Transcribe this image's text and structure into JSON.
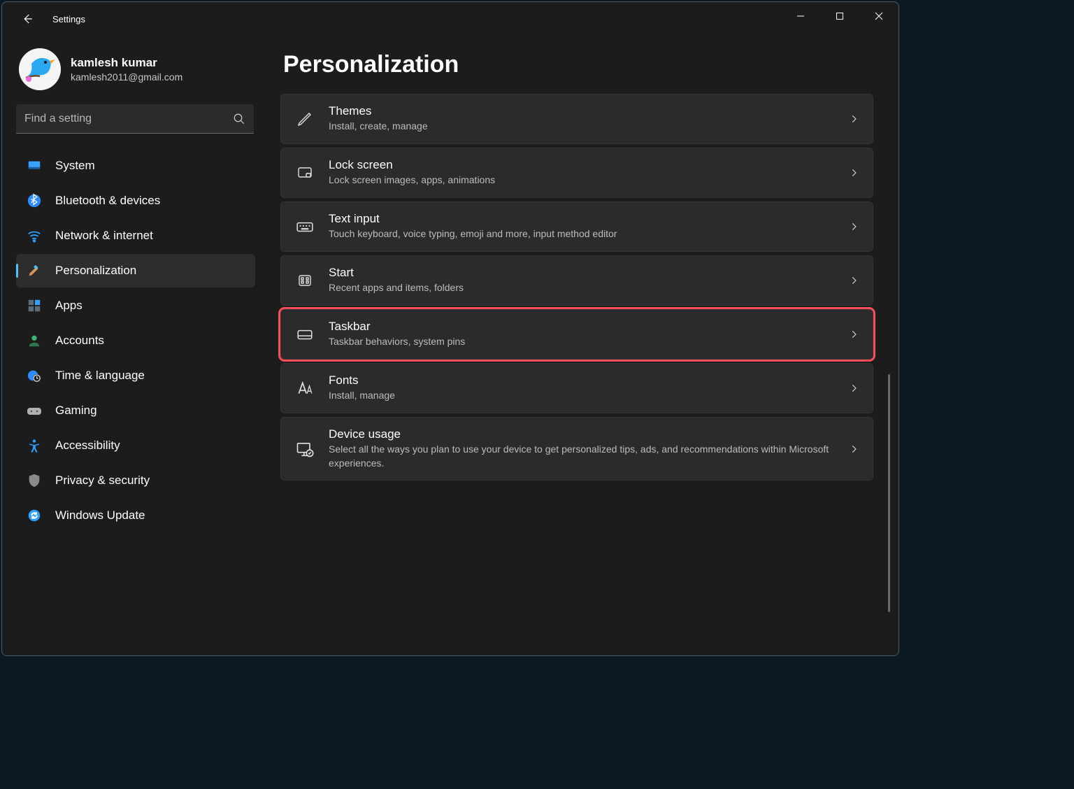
{
  "window": {
    "title": "Settings"
  },
  "user": {
    "name": "kamlesh kumar",
    "email": "kamlesh2011@gmail.com"
  },
  "search": {
    "placeholder": "Find a setting"
  },
  "nav": {
    "items": [
      {
        "label": "System",
        "icon": "display"
      },
      {
        "label": "Bluetooth & devices",
        "icon": "bluetooth"
      },
      {
        "label": "Network & internet",
        "icon": "wifi"
      },
      {
        "label": "Personalization",
        "icon": "brush",
        "selected": true
      },
      {
        "label": "Apps",
        "icon": "grid"
      },
      {
        "label": "Accounts",
        "icon": "person"
      },
      {
        "label": "Time & language",
        "icon": "clock-globe"
      },
      {
        "label": "Gaming",
        "icon": "gamepad"
      },
      {
        "label": "Accessibility",
        "icon": "accessibility"
      },
      {
        "label": "Privacy & security",
        "icon": "shield"
      },
      {
        "label": "Windows Update",
        "icon": "sync"
      }
    ]
  },
  "page": {
    "title": "Personalization",
    "cards": [
      {
        "title": "Themes",
        "desc": "Install, create, manage",
        "icon": "pen"
      },
      {
        "title": "Lock screen",
        "desc": "Lock screen images, apps, animations",
        "icon": "lock-screen"
      },
      {
        "title": "Text input",
        "desc": "Touch keyboard, voice typing, emoji and more, input method editor",
        "icon": "keyboard"
      },
      {
        "title": "Start",
        "desc": "Recent apps and items, folders",
        "icon": "start"
      },
      {
        "title": "Taskbar",
        "desc": "Taskbar behaviors, system pins",
        "icon": "taskbar",
        "highlighted": true
      },
      {
        "title": "Fonts",
        "desc": "Install, manage",
        "icon": "fonts"
      },
      {
        "title": "Device usage",
        "desc": "Select all the ways you plan to use your device to get personalized tips, ads, and recommendations within Microsoft experiences.",
        "icon": "device-check"
      }
    ]
  }
}
